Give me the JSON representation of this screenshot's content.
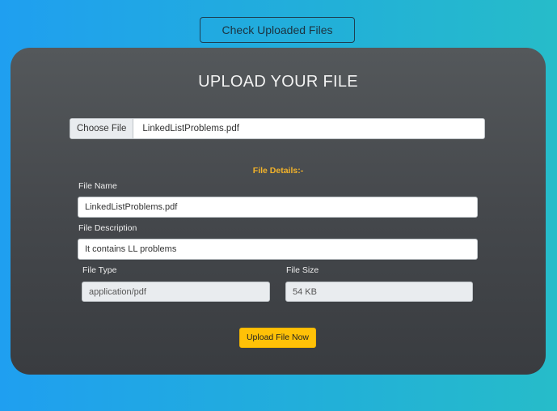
{
  "header": {
    "check_button_label": "Check Uploaded Files"
  },
  "form": {
    "title": "UPLOAD YOUR FILE",
    "file_picker": {
      "button_label": "Choose File",
      "chosen_file": "LinkedListProblems.pdf"
    },
    "details_heading": "File Details:-",
    "file_name": {
      "label": "File Name",
      "value": "LinkedListProblems.pdf"
    },
    "file_description": {
      "label": "File Description",
      "value": "It contains LL problems"
    },
    "file_type": {
      "label": "File Type",
      "value": "application/pdf"
    },
    "file_size": {
      "label": "File Size",
      "value": "54 KB"
    },
    "submit_label": "Upload File Now"
  },
  "colors": {
    "accent_yellow": "#ffc107",
    "heading_yellow": "#f3b32a",
    "card_background": "#45484c",
    "page_gradient_start": "#1f9ff0",
    "page_gradient_end": "#26bcc9"
  }
}
